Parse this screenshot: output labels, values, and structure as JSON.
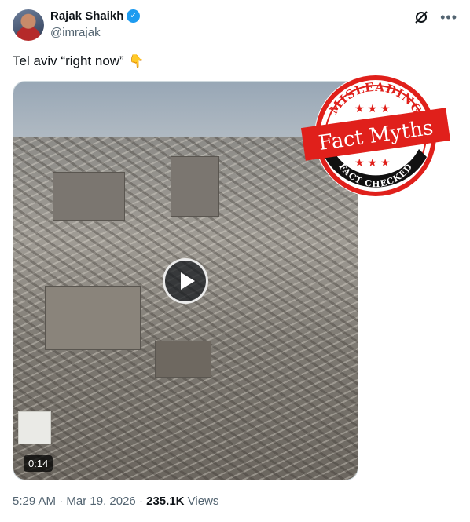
{
  "author": {
    "name": "Rajak Shaikh",
    "handle": "@imrajak_"
  },
  "icons": {
    "verified": "verified-badge-icon",
    "grok": "grok-icon",
    "more": "more-options-icon"
  },
  "tweet": {
    "text": "Tel aviv “right now”",
    "emoji": "👇"
  },
  "video": {
    "duration": "0:14"
  },
  "stamp": {
    "top": "MISLEADING",
    "middle": "Fact Myths",
    "bottom": "FACT CHECKED"
  },
  "meta": {
    "time": "5:29 AM",
    "sep1": "·",
    "date": "Mar 19, 2026",
    "sep2": "·",
    "views_count": "235.1K",
    "views_label": "Views"
  },
  "colors": {
    "accent": "#1d9bf0",
    "stamp_red": "#e0201b",
    "muted": "#536471"
  }
}
